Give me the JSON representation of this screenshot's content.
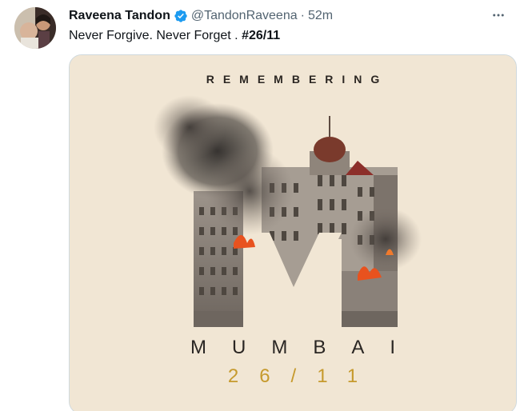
{
  "author": {
    "name": "Raveena Tandon",
    "handle": "@TandonRaveena",
    "separator": "·",
    "time": "52m",
    "avatar_icon": "profile-photo",
    "verified_icon": "verified-badge-icon"
  },
  "tweet": {
    "text": "Never Forgive. Never Forget . ",
    "hashtag": "#26/11"
  },
  "media": {
    "heading": "REMEMBERING",
    "city": "MUMBAI",
    "date": "26/11",
    "colors": {
      "background": "#f1e6d4",
      "accent_gold": "#c69a2d",
      "text_dark": "#2a2623",
      "fire": "#e8521e"
    }
  },
  "more_icon": "more-options-icon"
}
